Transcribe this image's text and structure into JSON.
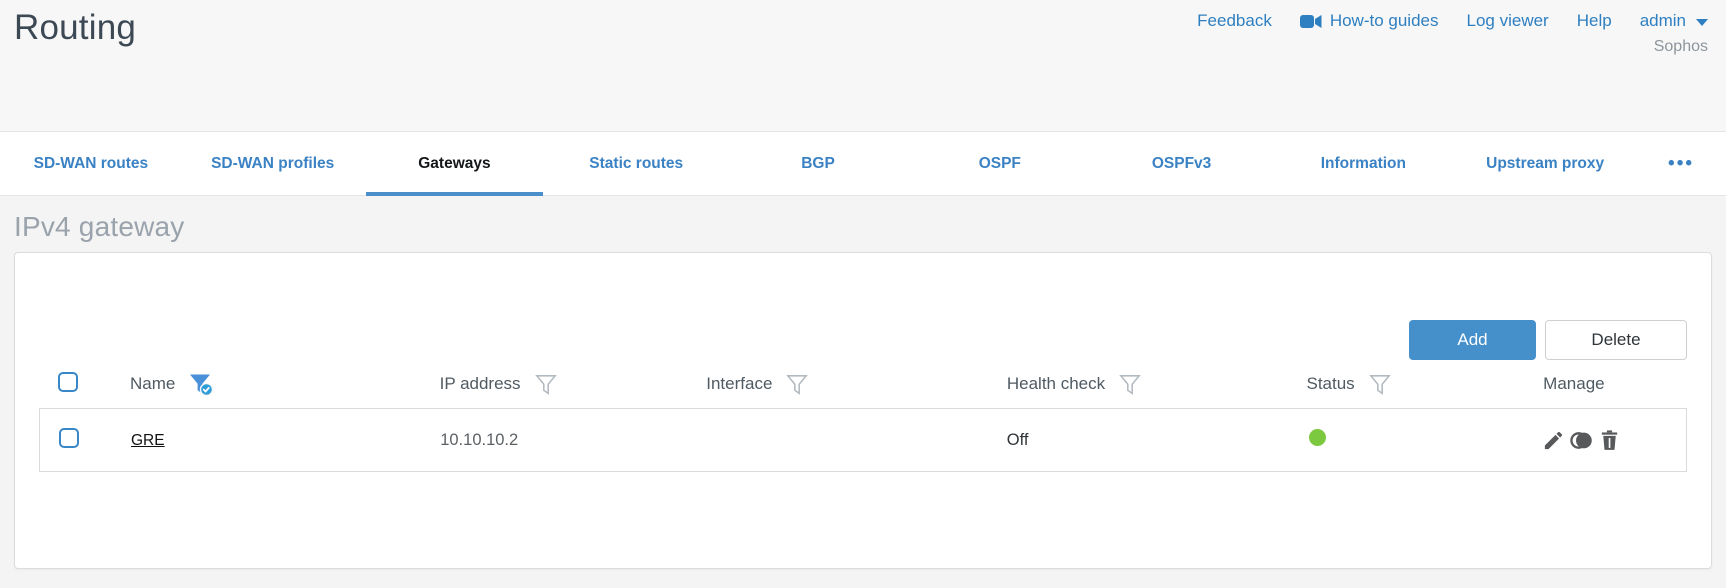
{
  "header": {
    "title": "Routing",
    "brand": "Sophos",
    "links": {
      "feedback": "Feedback",
      "howto": "How-to guides",
      "logviewer": "Log viewer",
      "help": "Help",
      "user": "admin"
    }
  },
  "tabs": {
    "items": [
      {
        "label": "SD-WAN routes",
        "active": false
      },
      {
        "label": "SD-WAN profiles",
        "active": false
      },
      {
        "label": "Gateways",
        "active": true
      },
      {
        "label": "Static routes",
        "active": false
      },
      {
        "label": "BGP",
        "active": false
      },
      {
        "label": "OSPF",
        "active": false
      },
      {
        "label": "OSPFv3",
        "active": false
      },
      {
        "label": "Information",
        "active": false
      },
      {
        "label": "Upstream proxy",
        "active": false
      }
    ],
    "more": "•••"
  },
  "section": {
    "title": "IPv4 gateway"
  },
  "toolbar": {
    "add": "Add",
    "delete": "Delete"
  },
  "table": {
    "columns": {
      "name": "Name",
      "ip": "IP address",
      "interface": "Interface",
      "health": "Health check",
      "status": "Status",
      "manage": "Manage"
    },
    "rows": [
      {
        "name": "GRE",
        "ip": "10.10.10.2",
        "interface": "",
        "health": "Off",
        "status_color": "#7cc93f"
      }
    ]
  },
  "colors": {
    "accent_blue": "#3a87c8",
    "link_blue": "#2e7fc1",
    "status_green": "#7cc93f",
    "icon_gray": "#58595b"
  }
}
